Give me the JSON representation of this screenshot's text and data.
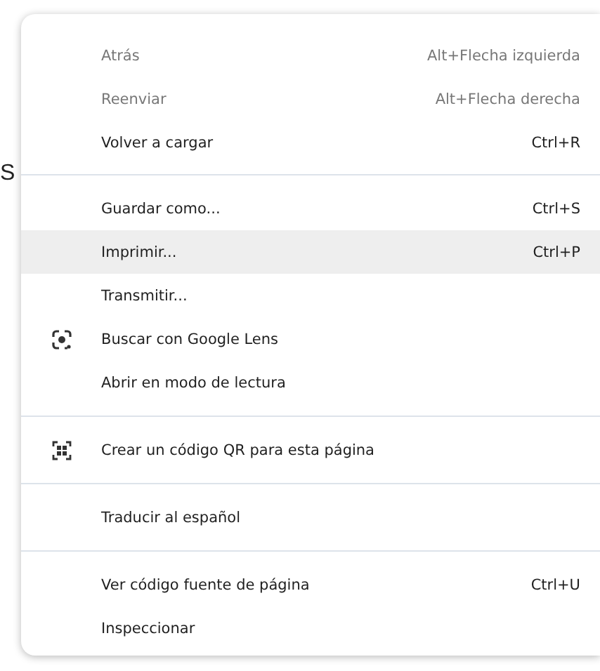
{
  "page": {
    "text": "S"
  },
  "menu": {
    "sections": [
      {
        "items": [
          {
            "kind": "plain",
            "label": "Atrás",
            "shortcut": "Alt+Flecha izquierda",
            "disabled": true,
            "selected": false
          },
          {
            "kind": "plain",
            "label": "Reenviar",
            "shortcut": "Alt+Flecha derecha",
            "disabled": true,
            "selected": false
          },
          {
            "kind": "plain",
            "label": "Volver a cargar",
            "shortcut": "Ctrl+R",
            "disabled": false,
            "selected": false
          }
        ]
      },
      {
        "items": [
          {
            "kind": "plain",
            "label": "Guardar como...",
            "shortcut": "Ctrl+S",
            "disabled": false,
            "selected": false
          },
          {
            "kind": "plain",
            "label": "Imprimir...",
            "shortcut": "Ctrl+P",
            "disabled": false,
            "selected": true
          },
          {
            "kind": "plain",
            "label": "Transmitir...",
            "disabled": false,
            "selected": false
          },
          {
            "kind": "lens",
            "label": "Buscar con Google Lens",
            "disabled": false,
            "selected": false
          },
          {
            "kind": "plain",
            "label": "Abrir en modo de lectura",
            "disabled": false,
            "selected": false
          }
        ]
      },
      {
        "items": [
          {
            "kind": "qr",
            "label": "Crear un código QR para esta página",
            "disabled": false,
            "selected": false
          }
        ]
      },
      {
        "items": [
          {
            "kind": "plain",
            "label": "Traducir al español",
            "disabled": false,
            "selected": false
          }
        ]
      },
      {
        "items": [
          {
            "kind": "plain",
            "label": "Ver código fuente de página",
            "shortcut": "Ctrl+U",
            "disabled": false,
            "selected": false
          },
          {
            "kind": "plain",
            "label": "Inspeccionar",
            "disabled": false,
            "selected": false
          }
        ]
      }
    ]
  }
}
